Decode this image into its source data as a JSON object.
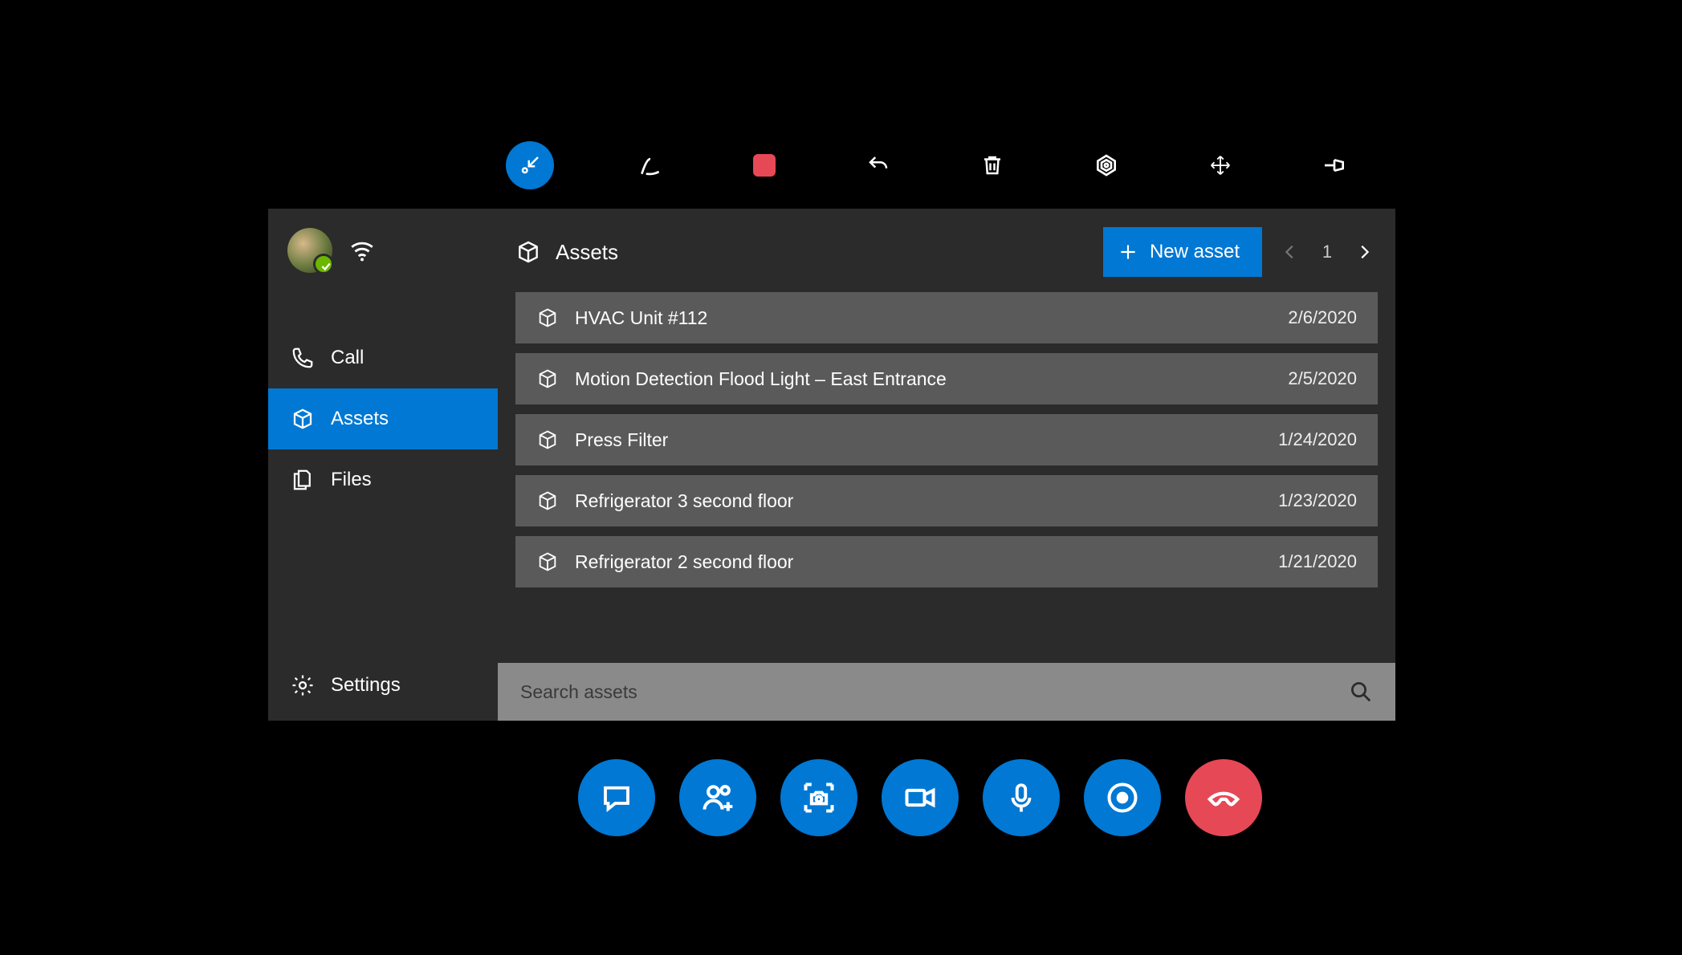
{
  "colors": {
    "accent": "#0078d4",
    "danger": "#e74856"
  },
  "top_toolbar": {
    "items": [
      {
        "name": "shrink-icon",
        "active": true
      },
      {
        "name": "ink-icon"
      },
      {
        "name": "color-square-icon"
      },
      {
        "name": "undo-icon"
      },
      {
        "name": "trash-icon"
      },
      {
        "name": "target-icon"
      },
      {
        "name": "expand-icon"
      },
      {
        "name": "pin-icon"
      }
    ]
  },
  "sidebar": {
    "items": [
      {
        "label": "Call",
        "icon": "phone-icon",
        "active": false
      },
      {
        "label": "Assets",
        "icon": "box-icon",
        "active": true
      },
      {
        "label": "Files",
        "icon": "files-icon",
        "active": false
      },
      {
        "label": "Settings",
        "icon": "gear-icon",
        "active": false
      }
    ]
  },
  "main": {
    "title": "Assets",
    "new_asset_label": "New asset",
    "pager": {
      "page": "1"
    },
    "assets": [
      {
        "name": "HVAC Unit #112",
        "date": "2/6/2020"
      },
      {
        "name": "Motion Detection Flood Light – East Entrance",
        "date": "2/5/2020"
      },
      {
        "name": "Press Filter",
        "date": "1/24/2020"
      },
      {
        "name": "Refrigerator 3 second floor",
        "date": "1/23/2020"
      },
      {
        "name": "Refrigerator 2 second floor",
        "date": "1/21/2020"
      }
    ],
    "search_placeholder": "Search assets"
  },
  "bottom_toolbar": {
    "items": [
      {
        "name": "chat-icon"
      },
      {
        "name": "add-people-icon"
      },
      {
        "name": "camera-capture-icon"
      },
      {
        "name": "video-icon"
      },
      {
        "name": "mic-icon"
      },
      {
        "name": "record-icon"
      },
      {
        "name": "hangup-icon",
        "red": true
      }
    ]
  }
}
